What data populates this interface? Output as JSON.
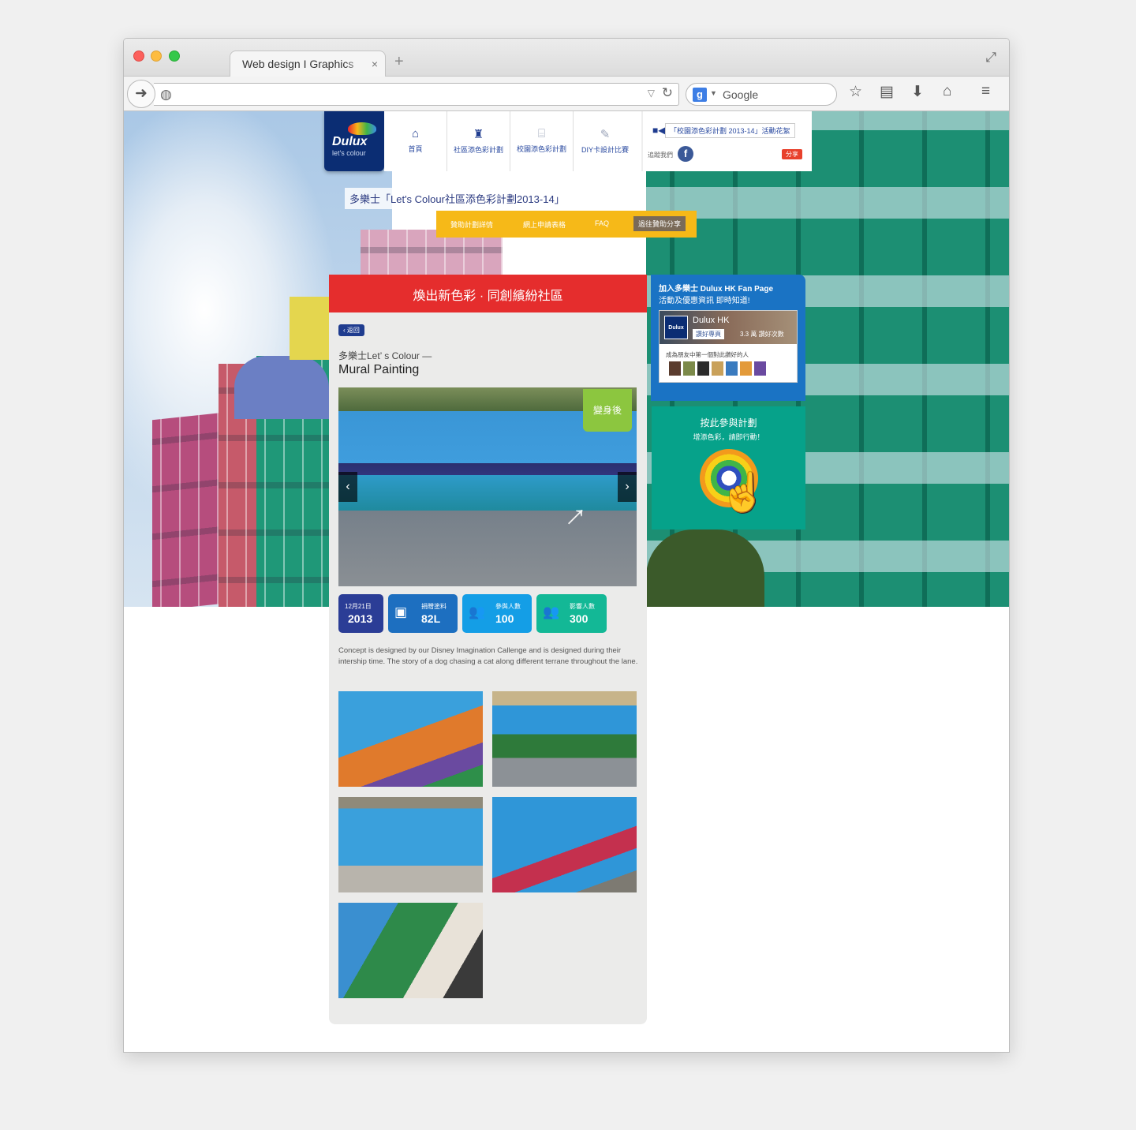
{
  "browser": {
    "tab_title": "Web design I Graphics",
    "tab_close": "×",
    "new_tab": "+",
    "search_placeholder": "Google",
    "search_engine_glyph": "g",
    "icons": [
      "back-icon",
      "globe-icon",
      "reload-icon",
      "star-icon",
      "reading-list-icon",
      "download-icon",
      "home-icon",
      "menu-icon",
      "expand-icon"
    ]
  },
  "site": {
    "logo_word": "Dulux",
    "logo_sub": "let's colour",
    "nav": [
      {
        "label": "首頁",
        "icon": "home-icon"
      },
      {
        "label": "社區添色彩計劃",
        "icon": "community-icon"
      },
      {
        "label": "校園添色彩計劃",
        "icon": "school-icon"
      },
      {
        "label": "DIY卡設計比賽",
        "icon": "design-icon"
      }
    ],
    "promo": "「校園添色彩計劃 2013-14」活動花絮",
    "follow_label": "追蹤我們",
    "share_label": "分享",
    "campaign_title": "多樂士「Let's Colour社區添色彩計劃2013-14」",
    "subnav": [
      "贊助計劃詳情",
      "網上申請表格",
      "FAQ",
      "過往贊助分享"
    ]
  },
  "content": {
    "slogan": "煥出新色彩 · 同創繽紛社區",
    "back_label": "‹ 返回",
    "project_label": "多樂士Let’ s Colour —",
    "project_title": "Mural Painting",
    "slide_tag": "變身後",
    "stats": {
      "date_day": "12月21日",
      "date_year": "2013",
      "paint_label": "捐贈塗料",
      "paint_value": "82L",
      "participants_label": "參與人數",
      "participants_value": "100",
      "impact_label": "影響人數",
      "impact_value": "300"
    },
    "description": "Concept is designed by our Disney Imagination Callenge and is designed during their intership time. The story of a dog chasing a cat along different terrane throughout the lane.",
    "thumbnail_count": 5
  },
  "sidebar": {
    "fan_title": "加入多樂士 Dulux HK Fan Page",
    "fan_sub": "活動及優惠資訊 即時知道!",
    "fan_name": "Dulux HK",
    "like_label": "讚好專頁",
    "fan_count": "3.3 萬 讚好次數",
    "friends_label": "成為朋友中第一個對此讚好的人",
    "join_title": "按此參與計劃",
    "join_sub": "增添色彩，請即行動！"
  },
  "colors": {
    "brand_navy": "#0b2d73",
    "slogan_red": "#e52d2d",
    "subnav_yellow": "#f6b918",
    "fan_blue": "#1a73c4",
    "join_teal": "#06a28a"
  }
}
